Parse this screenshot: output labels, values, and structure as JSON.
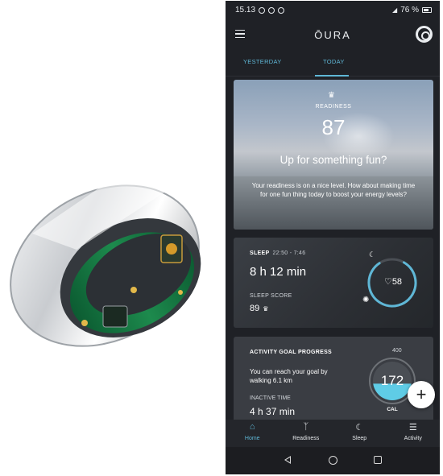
{
  "status_bar": {
    "time": "15.13",
    "battery": "76 %"
  },
  "app": {
    "logo": "ŌURA"
  },
  "tabs": [
    {
      "label": "YESTERDAY",
      "active": false
    },
    {
      "label": "TODAY",
      "active": true
    }
  ],
  "readiness": {
    "label": "READINESS",
    "score": "87",
    "headline": "Up for something fun?",
    "body": "Your readiness is on a nice level. How about making time for one fun thing today to boost your energy levels?"
  },
  "sleep": {
    "label": "SLEEP",
    "time_range": "22:50 - 7:46",
    "duration": "8 h 12 min",
    "score_label": "SLEEP SCORE",
    "score": "89",
    "heart_rate": "58"
  },
  "activity": {
    "label": "ACTIVITY GOAL PROGRESS",
    "body": "You can reach your goal by walking 6.1 km",
    "inactive_label": "INACTIVE TIME",
    "inactive_time": "4 h 37 min",
    "goal": "400",
    "calories": "172",
    "unit": "CAL",
    "progress_fraction": 0.43
  },
  "bottom_nav": [
    {
      "label": "Home",
      "icon": "home-icon",
      "active": true
    },
    {
      "label": "Readiness",
      "icon": "sprout-icon",
      "active": false
    },
    {
      "label": "Sleep",
      "icon": "moon-icon",
      "active": false
    },
    {
      "label": "Activity",
      "icon": "activity-list-icon",
      "active": false
    }
  ],
  "colors": {
    "accent": "#5fb7d6",
    "background": "#1f2126"
  }
}
